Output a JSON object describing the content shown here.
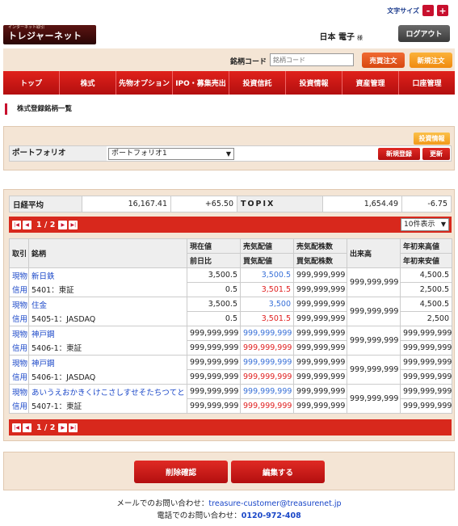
{
  "font_size": {
    "label": "文字サイズ",
    "minus": "-",
    "plus": "+"
  },
  "header": {
    "logo_small": "インターネット取引",
    "logo_main": "トレジャーネット",
    "user_name": "日本 電子",
    "honorific": "様",
    "logout": "ログアウト"
  },
  "codebar": {
    "label": "銘柄コード",
    "placeholder": "銘柄コード",
    "sell": "売買注文",
    "buy": "新規注文"
  },
  "nav": [
    "トップ",
    "株式",
    "先物オプション",
    "IPO・募集売出",
    "投資信託",
    "投資情報",
    "資産管理",
    "口座管理"
  ],
  "page_title": "株式登録銘柄一覧",
  "portfolio": {
    "invest_info": "投資情報",
    "label": "ポートフォリオ",
    "selected": "ポートフォリオ1",
    "new": "新規登録",
    "refresh": "更新"
  },
  "indices": {
    "nikkei_name": "日経平均",
    "nikkei_value": "16,167.41",
    "nikkei_change": "+65.50",
    "topix_name": "TOPIX",
    "topix_value": "1,654.49",
    "topix_change": "-6.75"
  },
  "pager": {
    "text": "1 / 2",
    "per_page": "10件表示"
  },
  "table": {
    "headers": {
      "trade": "取引",
      "name": "銘柄",
      "current": "現在値",
      "prev_change": "前日比",
      "ask": "売気配値",
      "bid": "買気配値",
      "ask_qty": "売気配株数",
      "bid_qty": "買気配株数",
      "volume": "出来高",
      "ytd_high": "年初来高値",
      "ytd_low": "年初来安値"
    },
    "rows": [
      {
        "t1": "現物",
        "t2": "信用",
        "name": "新日鉄",
        "code": "5401：東証",
        "cur": "3,500.5",
        "chg": "0.5",
        "ask": "3,500.5",
        "bid": "3,501.5",
        "askq": "999,999,999",
        "bidq": "999,999,999",
        "vol": "999,999,999",
        "high": "4,500.5",
        "low": "2,500.5"
      },
      {
        "t1": "現物",
        "t2": "信用",
        "name": "住金",
        "code": "5405-1：JASDAQ",
        "cur": "3,500.5",
        "chg": "0.5",
        "ask": "3,500",
        "bid": "3,501.5",
        "askq": "999,999,999",
        "bidq": "999,999,999",
        "vol": "999,999,999",
        "high": "4,500.5",
        "low": "2,500"
      },
      {
        "t1": "現物",
        "t2": "信用",
        "name": "神戸鋼",
        "code": "5406-1：東証",
        "cur": "999,999,999",
        "chg": "999,999,999",
        "ask": "999,999,999",
        "bid": "999,999,999",
        "askq": "999,999,999",
        "bidq": "999,999,999",
        "vol": "999,999,999",
        "high": "999,999,999",
        "low": "999,999,999"
      },
      {
        "t1": "現物",
        "t2": "信用",
        "name": "神戸鋼",
        "code": "5406-1：JASDAQ",
        "cur": "999,999,999",
        "chg": "999,999,999",
        "ask": "999,999,999",
        "bid": "999,999,999",
        "askq": "999,999,999",
        "bidq": "999,999,999",
        "vol": "999,999,999",
        "high": "999,999,999",
        "low": "999,999,999"
      },
      {
        "t1": "現物",
        "t2": "信用",
        "name": "あいうえおかきくけこさしすせそたちつてと",
        "code": "5407-1：東証",
        "cur": "999,999,999",
        "chg": "999,999,999",
        "ask": "999,999,999",
        "bid": "999,999,999",
        "askq": "999,999,999",
        "bidq": "999,999,999",
        "vol": "999,999,999",
        "high": "999,999,999",
        "low": "999,999,999"
      }
    ]
  },
  "actions": {
    "delete": "削除確認",
    "edit": "編集する"
  },
  "footer": {
    "mail_label": "メールでのお問い合わせ：",
    "mail": "treasure-customer@treasurenet.jp",
    "phone_label": "電話でのお問い合わせ：",
    "phone": "0120-972-408"
  },
  "colors": {
    "brand_red": "#c8102e",
    "panel_bg": "#f4e5d5",
    "link_blue": "#1a47c8",
    "ask_blue": "#3870d8",
    "bid_red": "#e02020"
  }
}
